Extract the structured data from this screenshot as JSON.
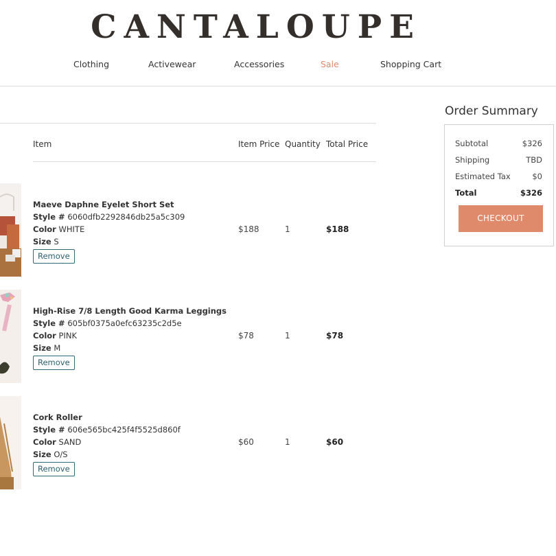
{
  "brand": {
    "logo_text": "CANTALOUPE"
  },
  "nav": {
    "items": [
      {
        "label": "Clothing"
      },
      {
        "label": "Activewear"
      },
      {
        "label": "Accessories"
      },
      {
        "label": "Sale"
      },
      {
        "label": "Shopping Cart"
      }
    ],
    "accent_color": "#dd8b6e"
  },
  "cart": {
    "columns": {
      "item": "Item",
      "item_price": "Item Price",
      "quantity": "Quantity",
      "total_price": "Total Price"
    },
    "labels": {
      "style": "Style #",
      "color": "Color",
      "size": "Size",
      "remove": "Remove"
    },
    "items": [
      {
        "name": "Maeve Daphne Eyelet Short Set",
        "style": "6060dfb2292846db25a5c309",
        "color": "WHITE",
        "size": "S",
        "price": "$188",
        "quantity": "1",
        "total": "$188"
      },
      {
        "name": "High-Rise 7/8 Length Good Karma Leggings",
        "style": "605bf0375a0efc63235c2d5e",
        "color": "PINK",
        "size": "M",
        "price": "$78",
        "quantity": "1",
        "total": "$78"
      },
      {
        "name": "Cork Roller",
        "style": "606e565bc425f4f5525d860f",
        "color": "SAND",
        "size": "O/S",
        "price": "$60",
        "quantity": "1",
        "total": "$60"
      }
    ]
  },
  "summary": {
    "title": "Order Summary",
    "subtotal_label": "Subtotal",
    "subtotal": "$326",
    "shipping_label": "Shipping",
    "shipping": "TBD",
    "tax_label": "Estimated Tax",
    "tax": "$0",
    "total_label": "Total",
    "total": "$326",
    "checkout_label": "CHECKOUT",
    "button_color": "#e08a6c"
  }
}
